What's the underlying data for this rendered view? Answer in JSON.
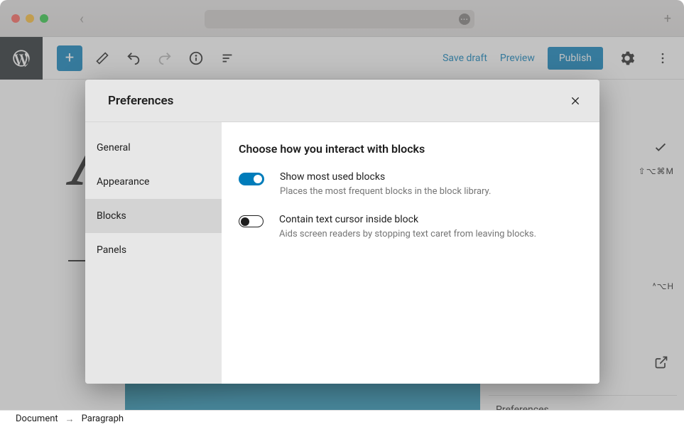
{
  "browser": {
    "back_icon": "‹"
  },
  "editor": {
    "save_draft": "Save draft",
    "preview": "Preview",
    "publish": "Publish"
  },
  "canvas": {
    "sample_letter": "A"
  },
  "sidebar_hints": {
    "shortcut1": "⇧⌥⌘M",
    "shortcut2": "^⌥H",
    "preferences": "Preferences"
  },
  "modal": {
    "title": "Preferences",
    "nav": {
      "general": "General",
      "appearance": "Appearance",
      "blocks": "Blocks",
      "panels": "Panels"
    },
    "content": {
      "heading": "Choose how you interact with blocks",
      "opt1": {
        "label": "Show most used blocks",
        "desc": "Places the most frequent blocks in the block library."
      },
      "opt2": {
        "label": "Contain text cursor inside block",
        "desc": "Aids screen readers by stopping text caret from leaving blocks."
      }
    }
  },
  "breadcrumb": {
    "root": "Document",
    "current": "Paragraph"
  }
}
